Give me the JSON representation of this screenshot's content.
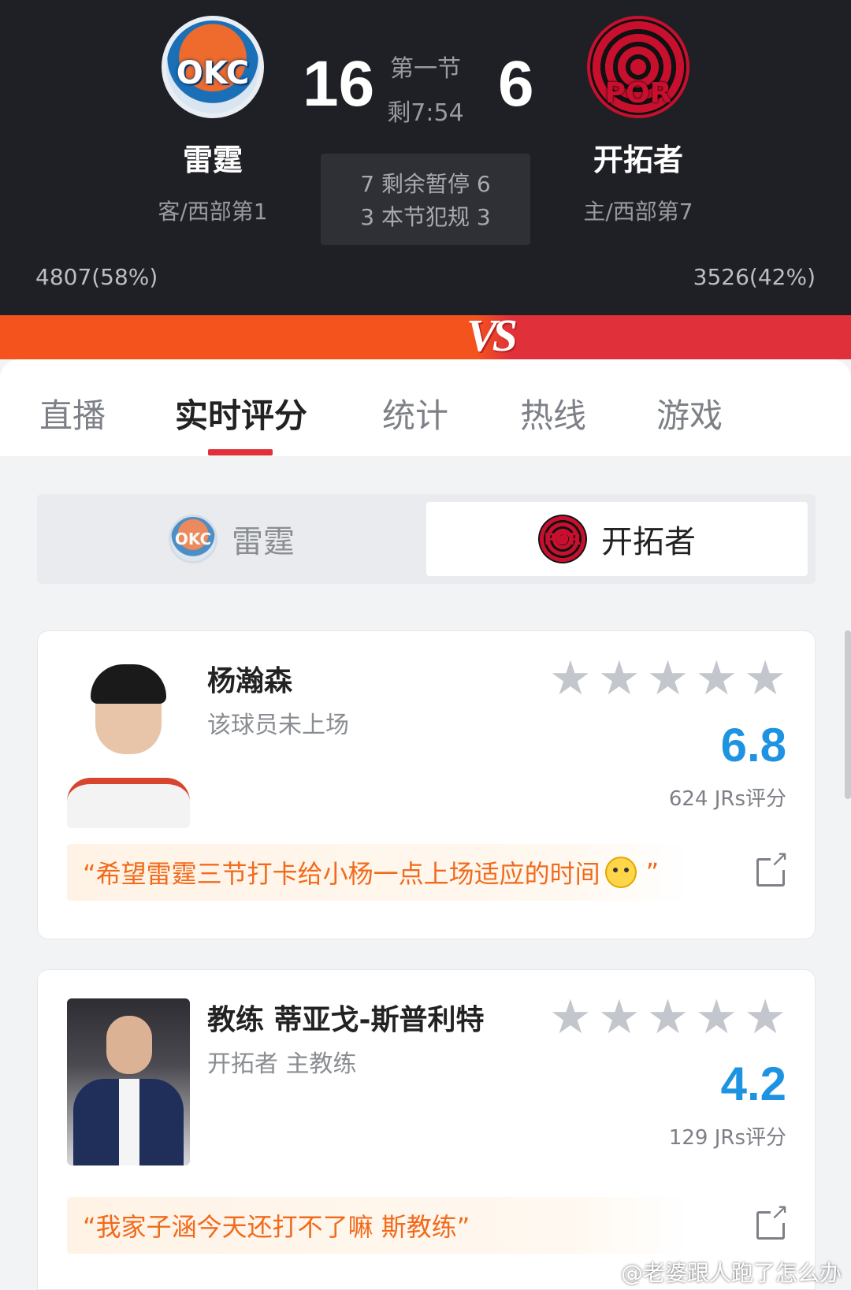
{
  "scoreboard": {
    "away": {
      "logo_text": "OKC",
      "name": "雷霆",
      "sub": "客/西部第1",
      "score": "16",
      "support": "4807(58%)"
    },
    "home": {
      "logo_text": "POR",
      "name": "开拓者",
      "sub": "主/西部第7",
      "score": "6",
      "support": "3526(42%)"
    },
    "period": "第一节",
    "clock": "剩7:54",
    "timeouts_line": "7 剩余暂停 6",
    "fouls_line": "3 本节犯规 3",
    "vs": "VS"
  },
  "tabs": [
    {
      "label": "直播"
    },
    {
      "label": "实时评分",
      "active": true
    },
    {
      "label": "统计"
    },
    {
      "label": "热线"
    },
    {
      "label": "游戏"
    }
  ],
  "team_toggle": {
    "left": {
      "logo_text": "OKC",
      "label": "雷霆"
    },
    "right": {
      "logo_text": "POR",
      "label": "开拓者",
      "selected": true
    }
  },
  "players": [
    {
      "name": "杨瀚森",
      "subtitle": "该球员未上场",
      "rating": "6.8",
      "votes": "624 JRs评分",
      "stars_filled": 0,
      "comment": "“希望雷霆三节打卡给小杨一点上场适应的时间",
      "comment_end": "”"
    },
    {
      "name": "教练 蒂亚戈-斯普利特",
      "subtitle": "开拓者 主教练",
      "rating": "4.2",
      "votes": "129 JRs评分",
      "stars_filled": 0,
      "comment": "“我家子涵今天还打不了嘛 斯教练”"
    }
  ],
  "watermark": "@老婆跟人跑了怎么办",
  "colors": {
    "accent_red": "#e0313a",
    "accent_orange": "#f4531d",
    "rating_blue": "#1e93e2",
    "comment_orange": "#f26a1b"
  }
}
